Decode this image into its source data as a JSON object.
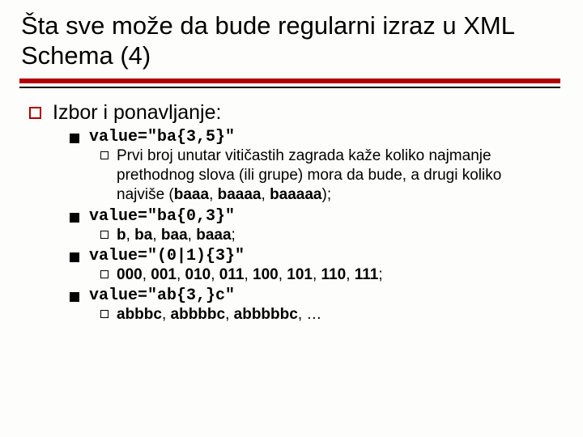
{
  "title": "Šta sve može da bude regularni izraz u XML Schema (4)",
  "l1": "Izbor i ponavljanje:",
  "items": [
    {
      "code": "value=\"ba{3,5}\"",
      "desc_pre": "Prvi broj unutar vitičastih zagrada kaže koliko najmanje prethodnog slova (ili grupe) mora da bude, a drugi koliko najviše (",
      "ex": [
        "baaa",
        "baaaa",
        "baaaaa"
      ],
      "desc_post": ");"
    },
    {
      "code": "value=\"ba{0,3}\"",
      "desc_pre": "",
      "ex": [
        "b",
        "ba",
        "baa",
        "baaa"
      ],
      "desc_post": ";"
    },
    {
      "code": "value=\"(0|1){3}\"",
      "desc_pre": "",
      "ex": [
        "000",
        "001",
        "010",
        "011",
        "100",
        "101",
        "110",
        "111"
      ],
      "desc_post": ";"
    },
    {
      "code": "value=\"ab{3,}c\"",
      "desc_pre": "",
      "ex": [
        "abbbc",
        "abbbbc",
        "abbbbbc"
      ],
      "desc_post": ", …"
    }
  ]
}
